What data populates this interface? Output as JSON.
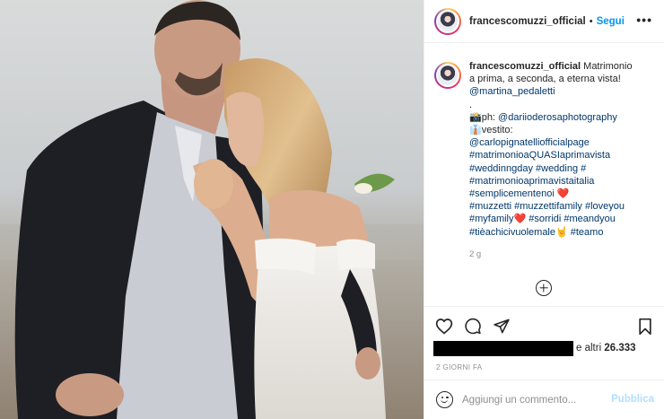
{
  "post": {
    "image_alt": "wedding photo"
  },
  "header": {
    "username": "francescomuzzi_official",
    "separator": "•",
    "follow_label": "Segui",
    "more_label": "•••"
  },
  "caption": {
    "username": "francescomuzzi_official",
    "lines": [
      {
        "text": "Matrimonio",
        "prefix_user": true
      },
      {
        "text": "a prima, a seconda, a eterna vista!"
      },
      {
        "text": "@martina_pedaletti",
        "tag": true
      },
      {
        "text": "."
      },
      {
        "text": "📸ph: ",
        "tag_text": "@dariioderosaphotography"
      },
      {
        "text": "👔vestito:"
      },
      {
        "text": "@carlopignatelliofficialpage",
        "tag": true
      },
      {
        "text": "#matrimonioaQUASIaprimavista",
        "tag": true
      },
      {
        "text": "#weddinngday #wedding #",
        "tag": true
      },
      {
        "text": "#matrimonioaprimavistaitalia",
        "tag": true
      },
      {
        "text": "#semplicementenoi ",
        "tag": true,
        "emoji": "❤️"
      },
      {
        "text": "#muzzetti #muzzettifamily #loveyou",
        "tag": true
      },
      {
        "text": "#myfamily",
        "tag": true,
        "emoji": "❤️",
        "after": " #sorridi #meandyou"
      },
      {
        "text": "#tièachicivuolemale",
        "tag": true,
        "emoji": "🤘",
        "after": " #teamo"
      }
    ],
    "time": "2 g"
  },
  "likes": {
    "prefix": "e altri ",
    "count": "26.333"
  },
  "date_label": "2 GIORNI FA",
  "comment": {
    "placeholder": "Aggiungi un commento...",
    "publish_label": "Pubblica"
  },
  "icons": {
    "like": "heart-icon",
    "comment": "comment-icon",
    "share": "share-icon",
    "save": "bookmark-icon",
    "emoji": "smile-icon",
    "load_more": "plus-circle-icon"
  },
  "colors": {
    "accent": "#0095f6",
    "tag": "#00376b",
    "muted": "#8e8e8e",
    "publish_disabled": "#b2dffc",
    "heart": "#e0245e"
  }
}
